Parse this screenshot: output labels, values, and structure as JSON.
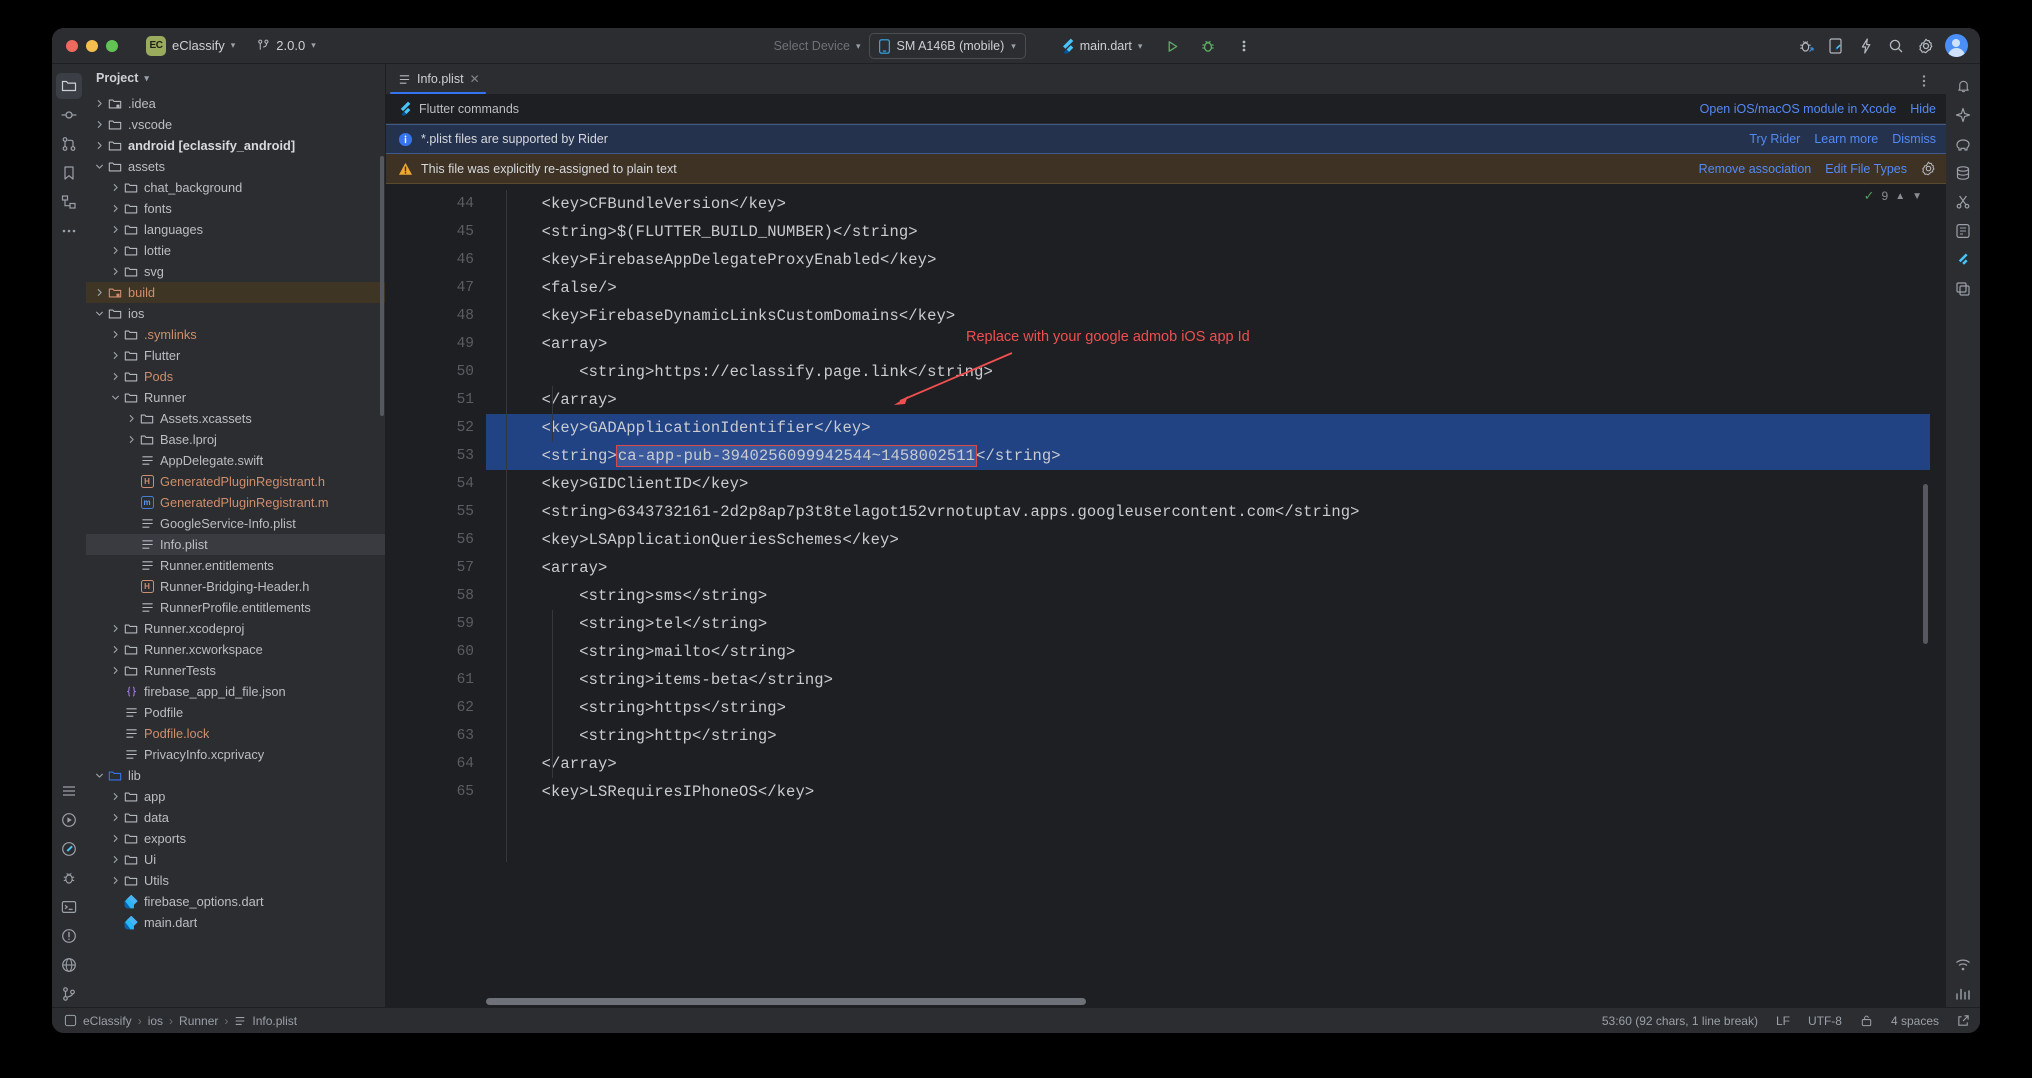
{
  "titlebar": {
    "project_badge": "EC",
    "project_name": "eClassify",
    "branch": "2.0.0",
    "select_device": "Select Device",
    "device": "SM A146B (mobile)",
    "run_config": "main.dart"
  },
  "sidebar": {
    "header": "Project",
    "items": [
      {
        "label": ".idea",
        "indent": 1,
        "arrow": "right",
        "icon": "folder-excluded",
        "style": "normal"
      },
      {
        "label": ".vscode",
        "indent": 1,
        "arrow": "right",
        "icon": "folder",
        "style": "normal"
      },
      {
        "label": "android [eclassify_android]",
        "indent": 1,
        "arrow": "right",
        "icon": "folder",
        "style": "module"
      },
      {
        "label": "assets",
        "indent": 1,
        "arrow": "down",
        "icon": "folder",
        "style": "normal"
      },
      {
        "label": "chat_background",
        "indent": 2,
        "arrow": "right",
        "icon": "folder",
        "style": "normal"
      },
      {
        "label": "fonts",
        "indent": 2,
        "arrow": "right",
        "icon": "folder",
        "style": "normal"
      },
      {
        "label": "languages",
        "indent": 2,
        "arrow": "right",
        "icon": "folder",
        "style": "normal"
      },
      {
        "label": "lottie",
        "indent": 2,
        "arrow": "right",
        "icon": "folder",
        "style": "normal"
      },
      {
        "label": "svg",
        "indent": 2,
        "arrow": "right",
        "icon": "folder",
        "style": "normal"
      },
      {
        "label": "build",
        "indent": 1,
        "arrow": "right",
        "icon": "folder-excluded-orange",
        "style": "orange",
        "row": "build-sel"
      },
      {
        "label": "ios",
        "indent": 1,
        "arrow": "down",
        "icon": "folder",
        "style": "normal"
      },
      {
        "label": ".symlinks",
        "indent": 2,
        "arrow": "right",
        "icon": "folder",
        "style": "orange"
      },
      {
        "label": "Flutter",
        "indent": 2,
        "arrow": "right",
        "icon": "folder",
        "style": "normal"
      },
      {
        "label": "Pods",
        "indent": 2,
        "arrow": "right",
        "icon": "folder",
        "style": "orange"
      },
      {
        "label": "Runner",
        "indent": 2,
        "arrow": "down",
        "icon": "folder",
        "style": "normal"
      },
      {
        "label": "Assets.xcassets",
        "indent": 3,
        "arrow": "right",
        "icon": "folder",
        "style": "normal"
      },
      {
        "label": "Base.lproj",
        "indent": 3,
        "arrow": "right",
        "icon": "folder",
        "style": "normal"
      },
      {
        "label": "AppDelegate.swift",
        "indent": 3,
        "arrow": "none",
        "icon": "file-text",
        "style": "normal"
      },
      {
        "label": "GeneratedPluginRegistrant.h",
        "indent": 3,
        "arrow": "none",
        "icon": "badge-h",
        "style": "orange"
      },
      {
        "label": "GeneratedPluginRegistrant.m",
        "indent": 3,
        "arrow": "none",
        "icon": "badge-m",
        "style": "orange"
      },
      {
        "label": "GoogleService-Info.plist",
        "indent": 3,
        "arrow": "none",
        "icon": "file-text",
        "style": "normal"
      },
      {
        "label": "Info.plist",
        "indent": 3,
        "arrow": "none",
        "icon": "file-text",
        "style": "normal",
        "row": "sel"
      },
      {
        "label": "Runner.entitlements",
        "indent": 3,
        "arrow": "none",
        "icon": "file-text",
        "style": "normal"
      },
      {
        "label": "Runner-Bridging-Header.h",
        "indent": 3,
        "arrow": "none",
        "icon": "badge-h",
        "style": "normal"
      },
      {
        "label": "RunnerProfile.entitlements",
        "indent": 3,
        "arrow": "none",
        "icon": "file-text",
        "style": "normal"
      },
      {
        "label": "Runner.xcodeproj",
        "indent": 2,
        "arrow": "right",
        "icon": "folder",
        "style": "normal"
      },
      {
        "label": "Runner.xcworkspace",
        "indent": 2,
        "arrow": "right",
        "icon": "folder",
        "style": "normal"
      },
      {
        "label": "RunnerTests",
        "indent": 2,
        "arrow": "right",
        "icon": "folder",
        "style": "normal"
      },
      {
        "label": "firebase_app_id_file.json",
        "indent": 2,
        "arrow": "none",
        "icon": "json",
        "style": "normal"
      },
      {
        "label": "Podfile",
        "indent": 2,
        "arrow": "none",
        "icon": "file-text",
        "style": "normal"
      },
      {
        "label": "Podfile.lock",
        "indent": 2,
        "arrow": "none",
        "icon": "file-text",
        "style": "orange"
      },
      {
        "label": "PrivacyInfo.xcprivacy",
        "indent": 2,
        "arrow": "none",
        "icon": "file-text",
        "style": "normal"
      },
      {
        "label": "lib",
        "indent": 1,
        "arrow": "down",
        "icon": "folder-blue",
        "style": "normal"
      },
      {
        "label": "app",
        "indent": 2,
        "arrow": "right",
        "icon": "folder",
        "style": "normal"
      },
      {
        "label": "data",
        "indent": 2,
        "arrow": "right",
        "icon": "folder",
        "style": "normal"
      },
      {
        "label": "exports",
        "indent": 2,
        "arrow": "right",
        "icon": "folder",
        "style": "normal"
      },
      {
        "label": "Ui",
        "indent": 2,
        "arrow": "right",
        "icon": "folder",
        "style": "normal"
      },
      {
        "label": "Utils",
        "indent": 2,
        "arrow": "right",
        "icon": "folder",
        "style": "normal"
      },
      {
        "label": "firebase_options.dart",
        "indent": 2,
        "arrow": "none",
        "icon": "dart",
        "style": "normal"
      },
      {
        "label": "main.dart",
        "indent": 2,
        "arrow": "none",
        "icon": "dart",
        "style": "normal"
      }
    ]
  },
  "editor": {
    "tab_label": "Info.plist",
    "notifications": [
      {
        "id": "flutter",
        "icon": "flutter-icon",
        "text": "Flutter commands",
        "actions": [
          "Open iOS/macOS module in Xcode",
          "Hide"
        ]
      },
      {
        "id": "rider",
        "icon": "info-icon",
        "text": "*.plist files are supported by Rider",
        "actions": [
          "Try Rider",
          "Learn more",
          "Dismiss"
        ]
      },
      {
        "id": "plaintext",
        "icon": "warning-icon",
        "text": "This file was explicitly re-assigned to plain text",
        "actions": [
          "Remove association",
          "Edit File Types"
        ]
      }
    ],
    "inspections_count": "9",
    "annotation": "Replace with your google admob iOS app Id",
    "highlighted_value": "ca-app-pub-3940256099942544~1458002511",
    "lines": [
      {
        "n": "44",
        "text": "    <key>CFBundleVersion</key>"
      },
      {
        "n": "45",
        "text": "    <string>$(FLUTTER_BUILD_NUMBER)</string>"
      },
      {
        "n": "46",
        "text": "    <key>FirebaseAppDelegateProxyEnabled</key>"
      },
      {
        "n": "47",
        "text": "    <false/>"
      },
      {
        "n": "48",
        "text": "    <key>FirebaseDynamicLinksCustomDomains</key>"
      },
      {
        "n": "49",
        "text": "    <array>"
      },
      {
        "n": "50",
        "text": "        <string>https://eclassify.page.link</string>"
      },
      {
        "n": "51",
        "text": "    </array>"
      },
      {
        "n": "52",
        "text": "    <key>GADApplicationIdentifier</key>",
        "hl": true,
        "bulb": true
      },
      {
        "n": "53",
        "text": "    <string>ca-app-pub-3940256099942544~1458002511</string>",
        "hl": true,
        "boxed": true
      },
      {
        "n": "54",
        "text": "    <key>GIDClientID</key>"
      },
      {
        "n": "55",
        "text": "    <string>6343732161-2d2p8ap7p3t8telagot152vrnotuptav.apps.googleusercontent.com</string>"
      },
      {
        "n": "56",
        "text": "    <key>LSApplicationQueriesSchemes</key>"
      },
      {
        "n": "57",
        "text": "    <array>"
      },
      {
        "n": "58",
        "text": "        <string>sms</string>"
      },
      {
        "n": "59",
        "text": "        <string>tel</string>"
      },
      {
        "n": "60",
        "text": "        <string>mailto</string>"
      },
      {
        "n": "61",
        "text": "        <string>items-beta</string>"
      },
      {
        "n": "62",
        "text": "        <string>https</string>"
      },
      {
        "n": "63",
        "text": "        <string>http</string>"
      },
      {
        "n": "64",
        "text": "    </array>"
      },
      {
        "n": "65",
        "text": "    <key>LSRequiresIPhoneOS</key>"
      }
    ]
  },
  "statusbar": {
    "project": "eClassify",
    "path1": "ios",
    "path2": "Runner",
    "file": "Info.plist",
    "caret": "53:60 (92 chars, 1 line break)",
    "line_sep": "LF",
    "encoding": "UTF-8",
    "indent": "4 spaces"
  },
  "colors": {
    "accent_blue": "#3574f0",
    "link_blue": "#548af7",
    "selection_blue": "#214283",
    "annotation_red": "#ef4f4f",
    "orange": "#cf8e6d",
    "warn_bg": "#3d3223",
    "info_bg": "#25324d"
  }
}
